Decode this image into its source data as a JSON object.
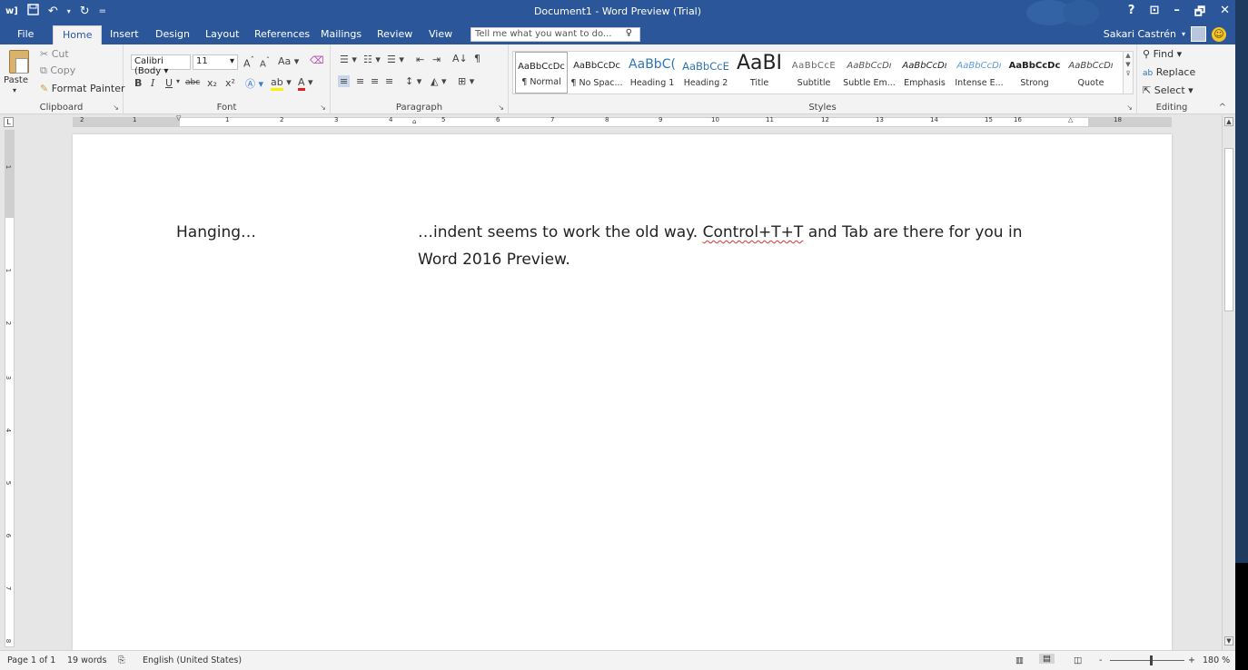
{
  "window": {
    "title": "Document1 - Word Preview (Trial)",
    "controls": [
      "?",
      "⊡",
      "–",
      "🗗",
      "✕"
    ]
  },
  "qat": {
    "word_icon": "w]",
    "save_icon": "save-icon",
    "undo_icon": "undo-icon",
    "redo_icon": "redo-icon",
    "customize_icon": "="
  },
  "tabs": [
    "File",
    "Home",
    "Insert",
    "Design",
    "Layout",
    "References",
    "Mailings",
    "Review",
    "View"
  ],
  "active_tab": "Home",
  "tell_me": {
    "placeholder": "Tell me what you want to do..."
  },
  "user": {
    "name": "Sakari Castrén"
  },
  "clipboard": {
    "paste": "Paste",
    "cut": "Cut",
    "copy": "Copy",
    "format_painter": "Format Painter",
    "label": "Clipboard"
  },
  "font": {
    "name": "Calibri (Body",
    "size": "11",
    "label": "Font",
    "buttons": [
      "B",
      "I",
      "U",
      "abc",
      "x₂",
      "x²",
      "A",
      "ab",
      "A"
    ],
    "grow": "A",
    "shrink": "A",
    "case": "Aa"
  },
  "paragraph": {
    "label": "Paragraph",
    "sort": "A↓",
    "pilcrow": "¶"
  },
  "styles": {
    "label": "Styles",
    "items": [
      {
        "preview": "AaBbCcDc",
        "name": "¶ Normal"
      },
      {
        "preview": "AaBbCcDc",
        "name": "¶ No Spac..."
      },
      {
        "preview": "AaBbC(",
        "name": "Heading 1"
      },
      {
        "preview": "AaBbCcE",
        "name": "Heading 2"
      },
      {
        "preview": "AaBI",
        "name": "Title"
      },
      {
        "preview": "AaBbCcE",
        "name": "Subtitle"
      },
      {
        "preview": "AaBbCcDı",
        "name": "Subtle Em..."
      },
      {
        "preview": "AaBbCcDı",
        "name": "Emphasis"
      },
      {
        "preview": "AaBbCcDı",
        "name": "Intense E..."
      },
      {
        "preview": "AaBbCcDc",
        "name": "Strong"
      },
      {
        "preview": "AaBbCcDı",
        "name": "Quote"
      }
    ]
  },
  "editing": {
    "label": "Editing",
    "find": "Find",
    "replace": "Replace",
    "select": "Select"
  },
  "ruler": {
    "numbers": [
      "2",
      "1",
      "1",
      "2",
      "3",
      "4",
      "5",
      "6",
      "7",
      "8",
      "9",
      "10",
      "11",
      "12",
      "13",
      "14",
      "15",
      "16",
      "18"
    ]
  },
  "vruler": {
    "numbers": [
      "1",
      "1",
      "2",
      "3",
      "4",
      "5",
      "6",
      "7",
      "8"
    ]
  },
  "document": {
    "col1": "Hanging…",
    "line1_pre": "…indent seems to work the old way. ",
    "line1_flag": "Control+T+T",
    "line1_post": " and Tab are there for you in",
    "line2": "Word 2016 Preview."
  },
  "status": {
    "page": "Page 1 of 1",
    "words": "19 words",
    "language": "English (United States)",
    "zoom_minus": "-",
    "zoom_plus": "+",
    "zoom": "180 %"
  },
  "colors": {
    "title_bar": "#2b579a",
    "ribbon": "#f3f3f3",
    "canvas": "#e6e6e6"
  }
}
